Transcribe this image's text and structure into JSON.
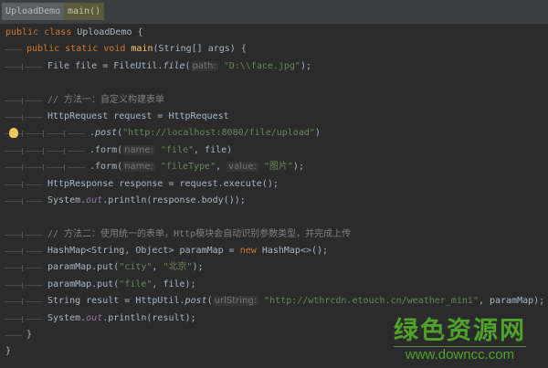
{
  "breadcrumb": [
    "UploadDemo",
    "main()"
  ],
  "lines": [
    {
      "i": 0,
      "t": [
        [
          "public class ",
          "kw"
        ],
        [
          "UploadDemo {",
          ""
        ]
      ]
    },
    {
      "i": 1,
      "t": [
        [
          "public static void ",
          "kw"
        ],
        [
          "main",
          "fn"
        ],
        [
          "(String[] args) {",
          ""
        ]
      ]
    },
    {
      "i": 2,
      "t": [
        [
          "File file = FileUtil.",
          ""
        ],
        [
          "file",
          "it"
        ],
        [
          "(",
          ""
        ],
        [
          "path:",
          "hint"
        ],
        [
          " ",
          ""
        ],
        [
          "\"D:\\\\face.jpg\"",
          "str"
        ],
        [
          ");",
          ""
        ]
      ]
    },
    {
      "i": 0,
      "t": []
    },
    {
      "i": 2,
      "t": [
        [
          "// 方法一：自定义构建表单",
          "cm"
        ]
      ]
    },
    {
      "i": 2,
      "t": [
        [
          "HttpRequest request = HttpRequest",
          ""
        ]
      ]
    },
    {
      "i": 4,
      "bulb": true,
      "t": [
        [
          ".",
          ""
        ],
        [
          "post",
          "it"
        ],
        [
          "(",
          ""
        ],
        [
          "\"http://localhost:8080/file/upload\"",
          "str"
        ],
        [
          ")",
          ""
        ]
      ]
    },
    {
      "i": 4,
      "t": [
        [
          ".form(",
          ""
        ],
        [
          "name:",
          "hint"
        ],
        [
          " ",
          ""
        ],
        [
          "\"file\"",
          "str"
        ],
        [
          ", file)",
          ""
        ]
      ]
    },
    {
      "i": 4,
      "t": [
        [
          ".form(",
          ""
        ],
        [
          "name:",
          "hint"
        ],
        [
          " ",
          ""
        ],
        [
          "\"fileType\"",
          "str"
        ],
        [
          ", ",
          ""
        ],
        [
          "value:",
          "hint"
        ],
        [
          " ",
          ""
        ],
        [
          "\"图片\"",
          "str"
        ],
        [
          ");",
          ""
        ]
      ]
    },
    {
      "i": 2,
      "t": [
        [
          "HttpResponse response = request.execute();",
          ""
        ]
      ]
    },
    {
      "i": 2,
      "t": [
        [
          "System.",
          ""
        ],
        [
          "out",
          "fld"
        ],
        [
          ".println(response.body());",
          ""
        ]
      ]
    },
    {
      "i": 0,
      "t": []
    },
    {
      "i": 2,
      "t": [
        [
          "// 方法二：使用统一的表单，Http模块会自动识别参数类型，并完成上传",
          "cm"
        ]
      ]
    },
    {
      "i": 2,
      "t": [
        [
          "HashMap<String, Object> paramMap = ",
          ""
        ],
        [
          "new ",
          "kw"
        ],
        [
          "HashMap<>();",
          ""
        ]
      ]
    },
    {
      "i": 2,
      "t": [
        [
          "paramMap.put(",
          ""
        ],
        [
          "\"city\"",
          "str"
        ],
        [
          ", ",
          ""
        ],
        [
          "\"北京\"",
          "str"
        ],
        [
          ");",
          ""
        ]
      ]
    },
    {
      "i": 2,
      "t": [
        [
          "paramMap.put(",
          ""
        ],
        [
          "\"file\"",
          "str"
        ],
        [
          ", file);",
          ""
        ]
      ]
    },
    {
      "i": 2,
      "t": [
        [
          "String result = HttpUtil.",
          ""
        ],
        [
          "post",
          "it"
        ],
        [
          "(",
          ""
        ],
        [
          "urlString:",
          "hint"
        ],
        [
          " ",
          ""
        ],
        [
          "\"http://wthrcdn.etouch.cn/weather_mini\"",
          "str"
        ],
        [
          ", paramMap);",
          ""
        ]
      ]
    },
    {
      "i": 2,
      "t": [
        [
          "System.",
          ""
        ],
        [
          "out",
          "fld"
        ],
        [
          ".println(result);",
          ""
        ]
      ]
    },
    {
      "i": 1,
      "t": [
        [
          "}",
          ""
        ]
      ]
    },
    {
      "i": 0,
      "t": [
        [
          "}",
          ""
        ]
      ]
    }
  ],
  "watermark": {
    "title": "绿色资源网",
    "url": "www.downcc.com"
  }
}
